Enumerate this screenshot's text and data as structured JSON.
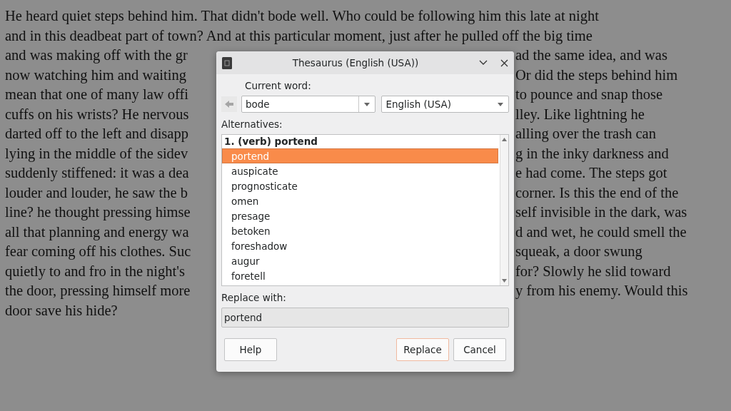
{
  "document": {
    "lines": [
      {
        "left": "He heard quiet steps behind him. That didn't bode well. Who could be following him this late at night"
      },
      {
        "left": "and in this deadbeat part of town? And at this particular moment, just after he pulled off the big time"
      },
      {
        "left": "and was making off with the gr",
        "right": "ad the same idea, and was"
      },
      {
        "left": "now watching him and waiting",
        "right": "Or did the steps behind him"
      },
      {
        "left": "mean that one of many law offi",
        "right": "to pounce and snap those"
      },
      {
        "left": "cuffs on his wrists? He nervous",
        "right": "lley. Like lightning he"
      },
      {
        "left": "darted off to the left and disapp",
        "right": "alling over the trash can"
      },
      {
        "left": "lying in the middle of the sidev",
        "right": "g in the inky darkness and"
      },
      {
        "left": "suddenly stiffened: it was a dea",
        "right": "e had come. The steps got"
      },
      {
        "left": "louder and louder, he saw the b",
        "right": "corner. Is this the end of the"
      },
      {
        "left": "line? he thought pressing himse",
        "right": "self invisible in the dark, was"
      },
      {
        "left": "all that planning and energy wa",
        "right": "d and wet, he could smell the"
      },
      {
        "left": "fear coming off his clothes. Suc",
        "right": "squeak, a door swung"
      },
      {
        "left": "quietly to and fro in the night's",
        "right": "for? Slowly he slid toward"
      },
      {
        "left": "the door, pressing himself more",
        "right": "y from his enemy. Would this"
      },
      {
        "left": "door save his hide?"
      }
    ]
  },
  "dialog": {
    "title": "Thesaurus (English (USA))",
    "current_word_label": "Current word:",
    "back_button": {
      "disabled": true
    },
    "current_word": "bode",
    "language": "English (USA)",
    "alternatives_label": "Alternatives:",
    "alternatives_heading": "1. (verb) portend",
    "alternatives": [
      {
        "label": "portend",
        "selected": true
      },
      {
        "label": "auspicate",
        "selected": false
      },
      {
        "label": "prognosticate",
        "selected": false
      },
      {
        "label": "omen",
        "selected": false
      },
      {
        "label": "presage",
        "selected": false
      },
      {
        "label": "betoken",
        "selected": false
      },
      {
        "label": "foreshadow",
        "selected": false
      },
      {
        "label": "augur",
        "selected": false
      },
      {
        "label": "foretell",
        "selected": false
      }
    ],
    "replace_label": "Replace with:",
    "replace_value": "portend",
    "buttons": [
      {
        "label": "Help",
        "kind": "normal"
      },
      {
        "label": "Replace",
        "kind": "default"
      },
      {
        "label": "Cancel",
        "kind": "normal"
      }
    ]
  }
}
